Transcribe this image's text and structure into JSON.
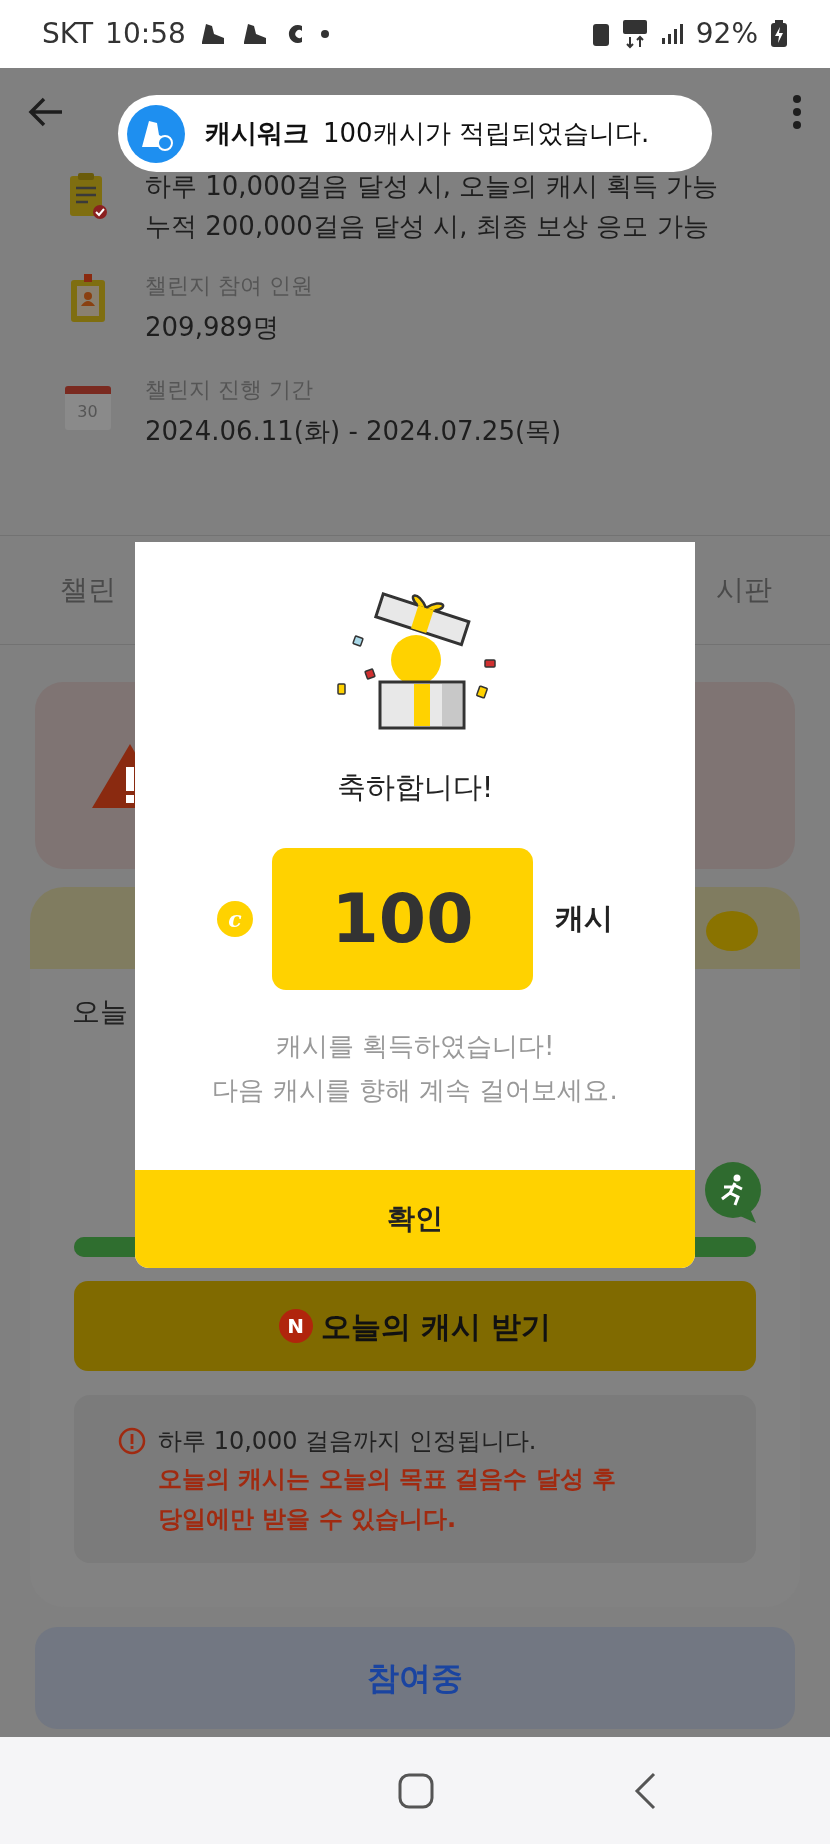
{
  "status_bar": {
    "carrier": "SKT",
    "time": "10:58",
    "battery": "92%"
  },
  "toast": {
    "app": "캐시워크",
    "message": "100캐시가 적립되었습니다."
  },
  "info": [
    {
      "kind": "rules",
      "lines": [
        "하루 10,000걸음 달성 시, 오늘의 캐시 획득 가능",
        "누적 200,000걸음 달성 시, 최종 보상 응모 가능"
      ]
    },
    {
      "kind": "people",
      "label": "챌린지 참여 인원",
      "value": "209,989명"
    },
    {
      "kind": "calendar",
      "label": "챌린지 진행 기간",
      "value": "2024.06.11(화) - 2024.07.25(목)",
      "day": "30"
    }
  ],
  "tabs": [
    "챌린",
    "시판"
  ],
  "today_card": {
    "title": "오늘",
    "level": 1,
    "claim_badge": "N",
    "claim_button": "오늘의 캐시 받기",
    "notice": "하루 10,000 걸음까지 인정됩니다.",
    "warning_lines": [
      "오늘의 캐시는 오늘의 목표 걸음수 달성 후",
      "당일에만 받을 수 있습니다."
    ]
  },
  "join_button": "참여중",
  "dialog": {
    "title": "축하합니다!",
    "coin": "c",
    "amount": "100",
    "unit": "캐시",
    "message_lines": [
      "캐시를 획득하였습니다!",
      "다음 캐시를 향해 계속 걸어보세요."
    ],
    "confirm": "확인"
  }
}
